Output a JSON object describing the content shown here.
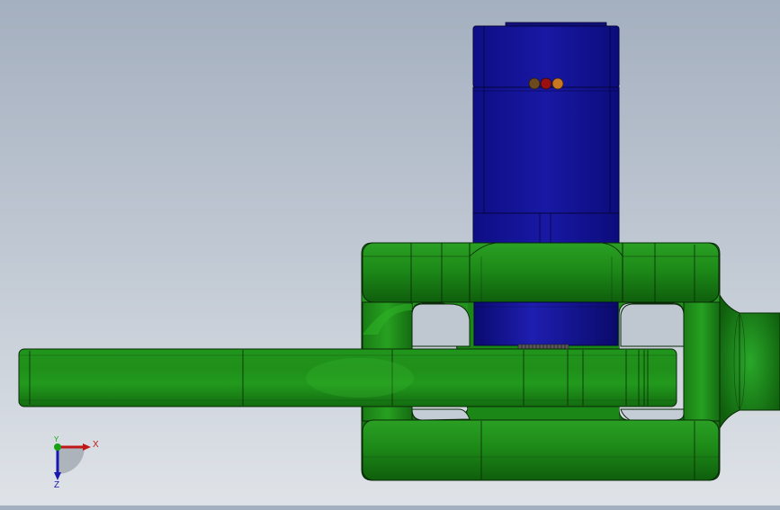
{
  "viewport": {
    "background_top": "#a4afbf",
    "background_bottom": "#dfe3e8"
  },
  "model": {
    "motor_color": "#14149a",
    "bracket_color": "#1f8a1a",
    "edge_color": "#0a2a08",
    "indicator_lights": [
      "#6b4a1e",
      "#9a1010",
      "#c87820"
    ]
  },
  "triad": {
    "x_label": "X",
    "y_label": "Y",
    "z_label": "Z",
    "x_color": "#c01818",
    "y_color": "#18a018",
    "z_color": "#1818b0"
  }
}
